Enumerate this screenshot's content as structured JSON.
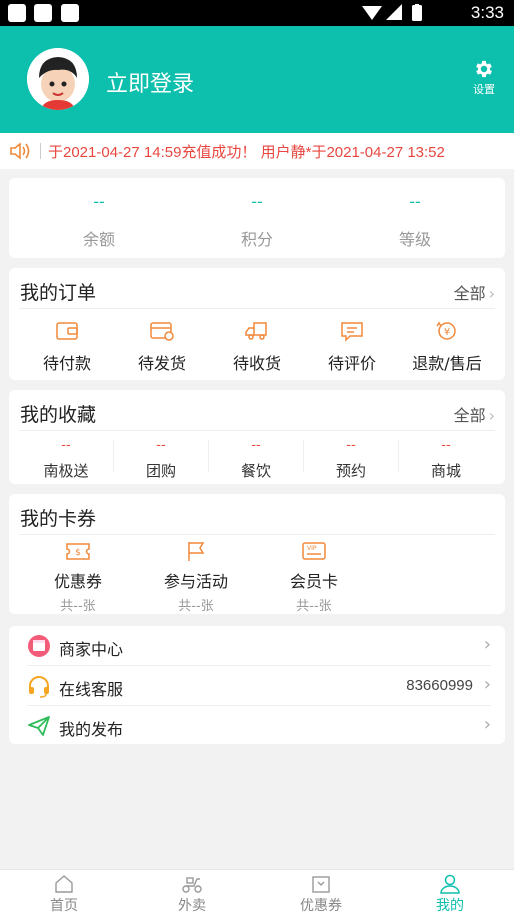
{
  "status_bar": {
    "time": "3:33"
  },
  "header": {
    "login_label": "立即登录",
    "settings_label": "设置"
  },
  "marquee": {
    "text": "于2021-04-27 14:59充值成功！   用户静*于2021-04-27 13:52"
  },
  "stats": [
    {
      "value": "--",
      "label": "余额"
    },
    {
      "value": "--",
      "label": "积分"
    },
    {
      "value": "--",
      "label": "等级"
    }
  ],
  "orders": {
    "title": "我的订单",
    "more": "全部",
    "items": [
      {
        "label": "待付款",
        "icon": "wallet-icon"
      },
      {
        "label": "待发货",
        "icon": "card-icon"
      },
      {
        "label": "待收货",
        "icon": "truck-icon"
      },
      {
        "label": "待评价",
        "icon": "comment-icon"
      },
      {
        "label": "退款/售后",
        "icon": "refund-icon"
      }
    ]
  },
  "favorites": {
    "title": "我的收藏",
    "more": "全部",
    "items": [
      {
        "value": "--",
        "label": "南极送"
      },
      {
        "value": "--",
        "label": "团购"
      },
      {
        "value": "--",
        "label": "餐饮"
      },
      {
        "value": "--",
        "label": "预约"
      },
      {
        "value": "--",
        "label": "商城"
      }
    ]
  },
  "coupons": {
    "title": "我的卡券",
    "items": [
      {
        "label": "优惠券",
        "count": "共--张",
        "icon": "coupon-icon"
      },
      {
        "label": "参与活动",
        "count": "共--张",
        "icon": "flag-icon"
      },
      {
        "label": "会员卡",
        "count": "共--张",
        "icon": "vip-card-icon"
      }
    ]
  },
  "menu": [
    {
      "label": "商家中心",
      "extra": "",
      "icon": "shop-icon"
    },
    {
      "label": "在线客服",
      "extra": "83660999",
      "icon": "headset-icon"
    },
    {
      "label": "我的发布",
      "extra": "",
      "icon": "send-icon"
    }
  ],
  "tabbar": [
    {
      "label": "首页",
      "icon": "home-icon"
    },
    {
      "label": "外卖",
      "icon": "scooter-icon"
    },
    {
      "label": "优惠券",
      "icon": "coupon-tab-icon"
    },
    {
      "label": "我的",
      "icon": "user-icon"
    }
  ],
  "colors": {
    "primary": "#0dbfad",
    "accent": "#e8473f",
    "icon_orange": "#f0883a"
  }
}
